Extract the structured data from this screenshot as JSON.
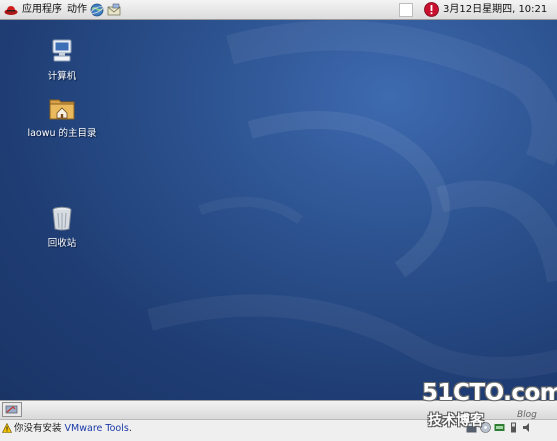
{
  "top_panel": {
    "menus": {
      "applications": "应用程序",
      "actions": "动作"
    },
    "clock": "3月12日星期四, 10:21"
  },
  "desktop": {
    "icons": [
      {
        "label": "计算机",
        "icon": "computer-icon"
      },
      {
        "label": "laowu 的主目录",
        "icon": "home-folder-icon"
      },
      {
        "label": "回收站",
        "icon": "trash-icon"
      }
    ]
  },
  "status_bar": {
    "text_prefix": "你没有安装",
    "tools_label": "VMware Tools",
    "text_suffix": "."
  },
  "watermark": {
    "site": "51CTO.com",
    "subtitle": "技术博客",
    "blog": "Blog"
  },
  "colors": {
    "desktop_blue": "#2c528f",
    "panel_gray": "#dcdcdc",
    "update_red": "#c8102e"
  }
}
